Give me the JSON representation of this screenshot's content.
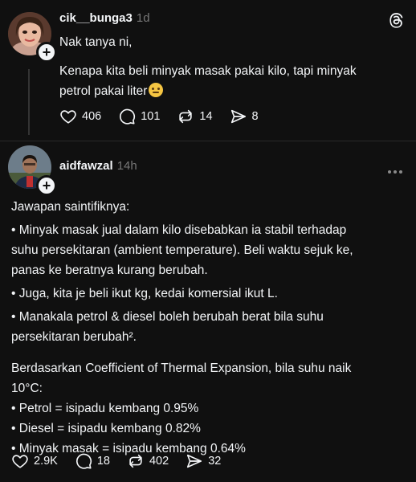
{
  "post1": {
    "username": "cik__bunga3",
    "time": "1d",
    "line1": "Nak tanya ni,",
    "line2": "Kenapa kita beli minyak masak pakai kilo, tapi minyak",
    "line3": "petrol pakai liter",
    "emoji": "thinking-face-emoji",
    "likes": "406",
    "comments": "101",
    "reposts": "14",
    "shares": "8"
  },
  "post2": {
    "username": "aidfawzal",
    "time": "14h",
    "lines": [
      "Jawapan saintifiknya:",
      "• Minyak masak jual dalam kilo disebabkan ia stabil terhadap",
      "suhu persekitaran (ambient temperature). Beli waktu sejuk ke,",
      "panas ke beratnya kurang berubah.",
      "• Juga, kita je beli ikut kg, kedai komersial ikut L.",
      "• Manakala petrol & diesel boleh berubah berat bila suhu",
      "persekitaran berubah².",
      "Berdasarkan Coefficient of Thermal Expansion, bila suhu naik",
      "10°C:",
      "• Petrol = isipadu kembang 0.95%",
      "• Diesel = isipadu kembang 0.82%",
      "• Minyak masak = isipadu kembang 0.64%"
    ],
    "likes": "2.9K",
    "comments": "18",
    "reposts": "402",
    "shares": "32"
  },
  "icons": {
    "app": "threads-logo-icon",
    "more": "more-options-icon",
    "like": "heart-icon",
    "comment": "comment-icon",
    "repost": "repost-icon",
    "share": "share-icon",
    "follow": "plus-icon"
  },
  "colors": {
    "background": "#101010",
    "text": "#f3f5f7",
    "muted": "#777777"
  }
}
